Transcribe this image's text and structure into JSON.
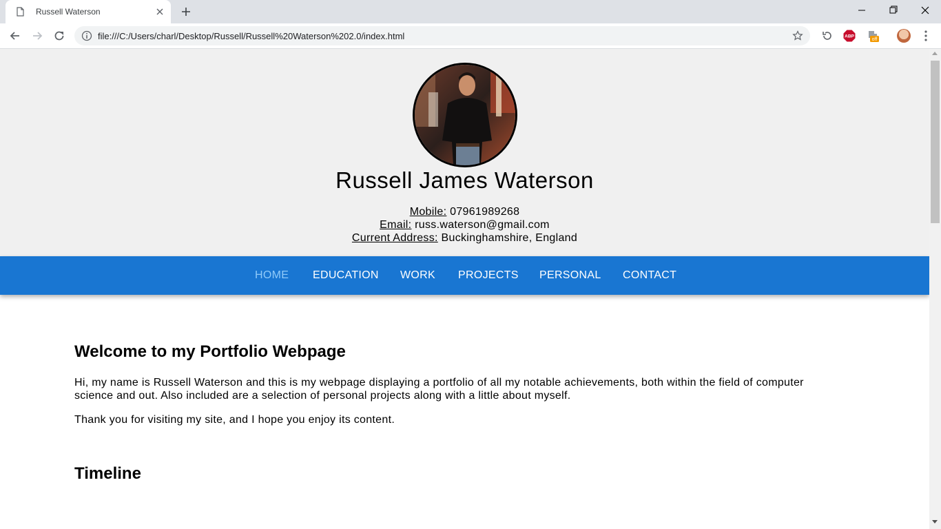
{
  "browser": {
    "tab_title": "Russell Waterson",
    "url": "file:///C:/Users/charl/Desktop/Russell/Russell%20Waterson%202.0/index.html",
    "extensions": [
      "history-icon",
      "adblock-icon",
      "extension-off-icon"
    ],
    "ext_off_badge": "off",
    "abp_label": "ABP"
  },
  "header": {
    "name": "Russell James Waterson",
    "mobile_label": "Mobile:",
    "mobile_value": "07961989268",
    "email_label": "Email:",
    "email_value": "russ.waterson@gmail.com",
    "address_label": "Current Address:",
    "address_value": "Buckinghamshire, England"
  },
  "nav": {
    "items": [
      {
        "label": "HOME",
        "active": true
      },
      {
        "label": "EDUCATION",
        "active": false
      },
      {
        "label": "WORK",
        "active": false
      },
      {
        "label": "PROJECTS",
        "active": false
      },
      {
        "label": "PERSONAL",
        "active": false
      },
      {
        "label": "CONTACT",
        "active": false
      }
    ],
    "bar_color": "#1976d2",
    "active_color": "#90caf9"
  },
  "main": {
    "welcome_heading": "Welcome to my Portfolio Webpage",
    "intro_paragraph": "Hi, my name is Russell Waterson and this is my webpage displaying a portfolio of all my notable achievements, both within the field of computer science and out. Also included are a selection of personal projects along with a little about myself.",
    "thanks_paragraph": "Thank you for visiting my site, and I hope you enjoy its content.",
    "timeline_heading": "Timeline"
  }
}
